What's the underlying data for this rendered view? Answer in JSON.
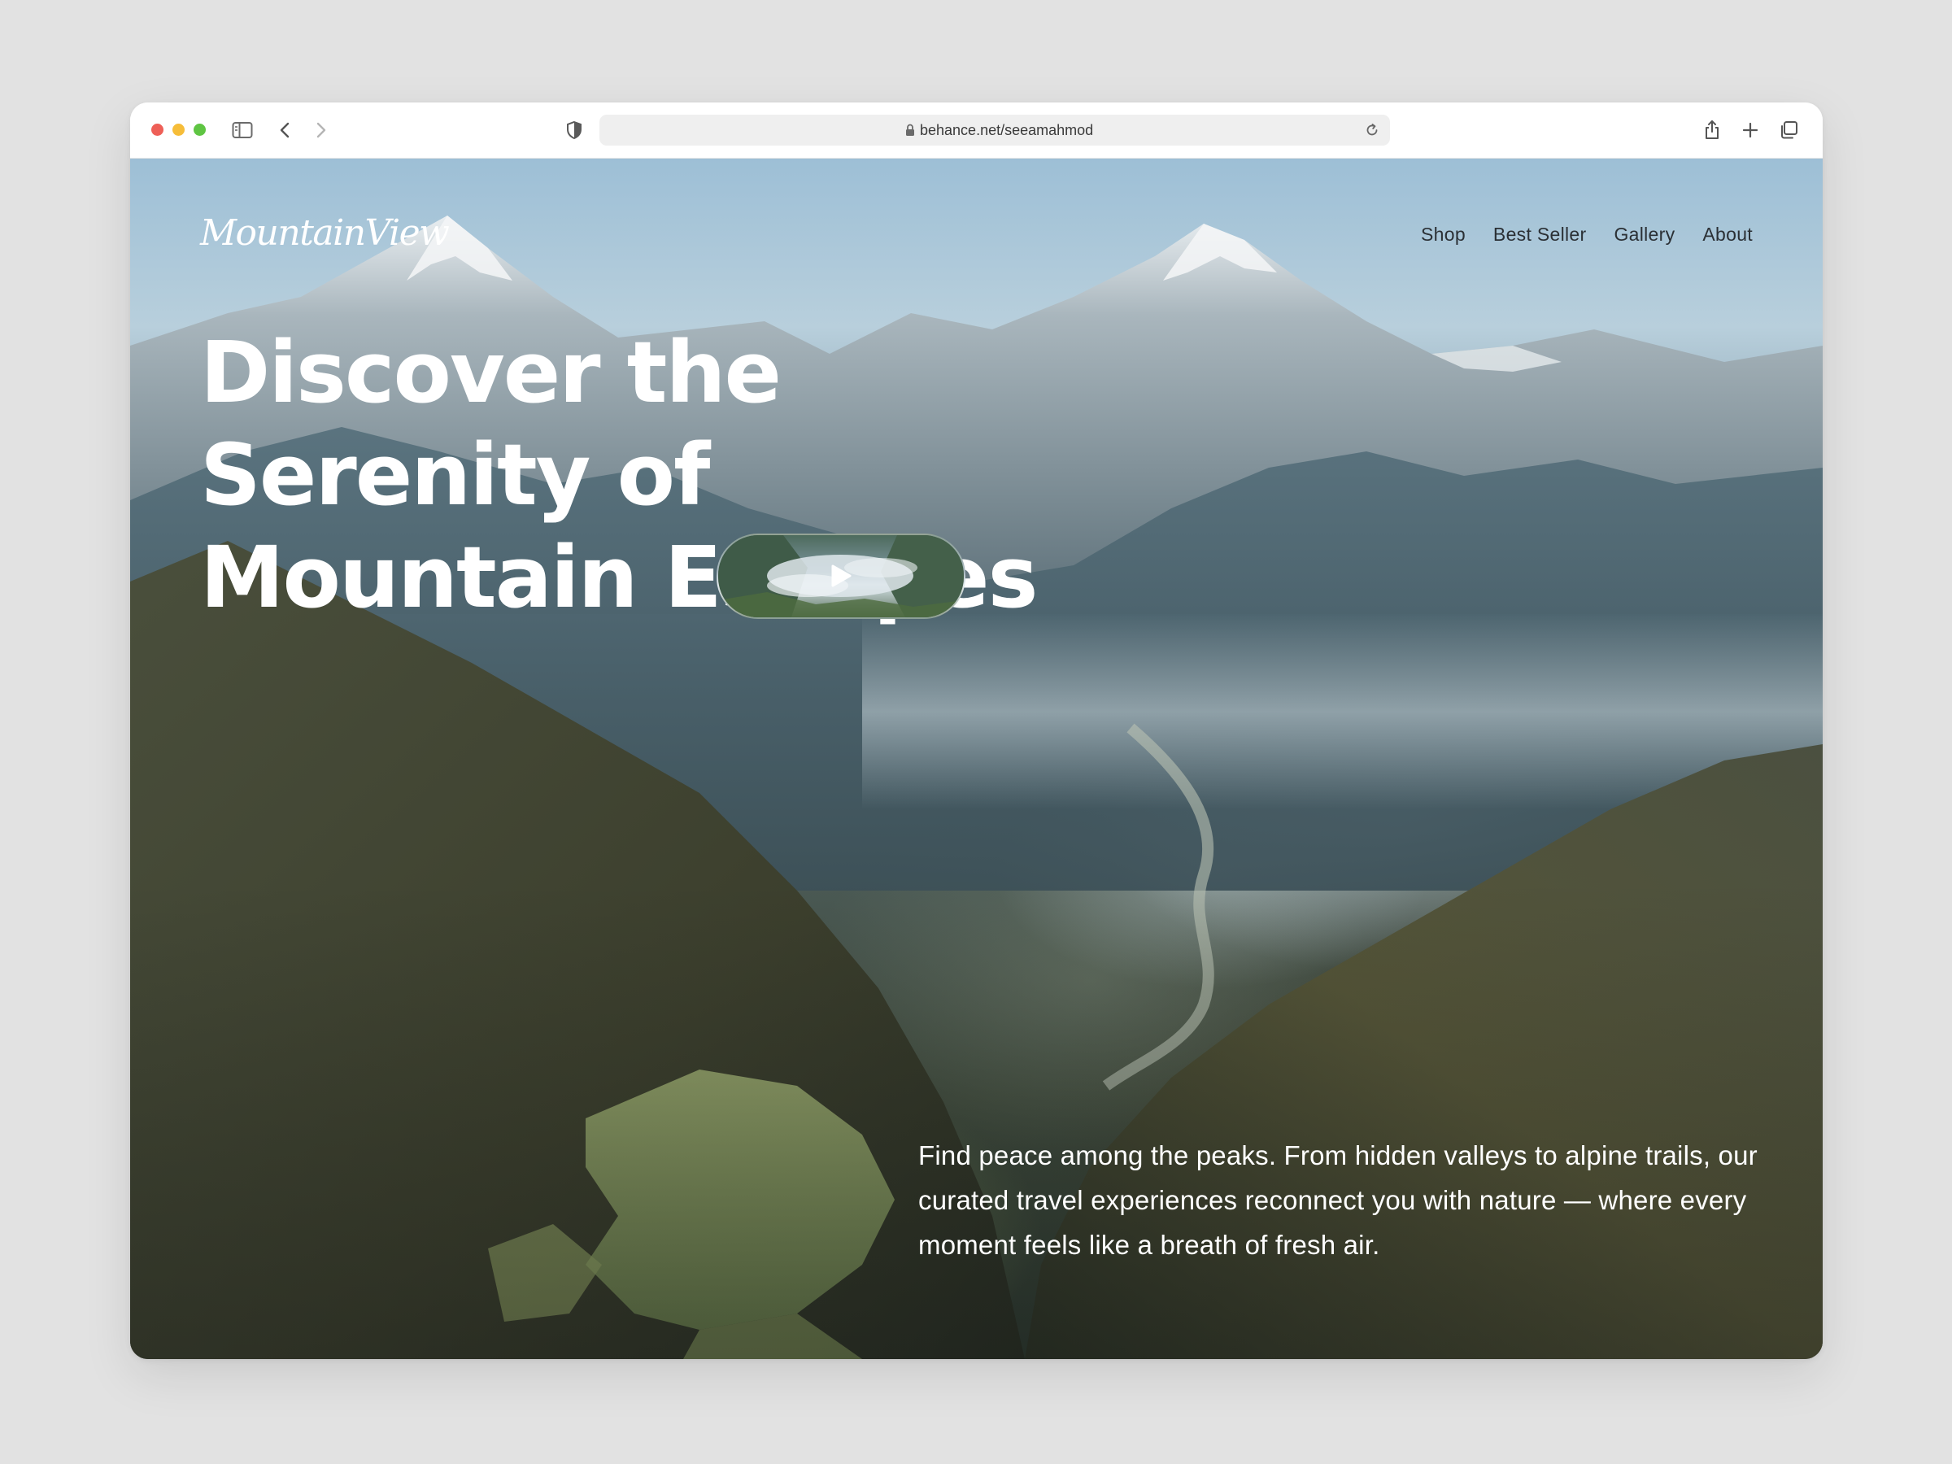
{
  "browser": {
    "url": "behance.net/seeamahmod",
    "icons": [
      "sidebar-icon",
      "back-icon",
      "forward-icon",
      "shield-icon",
      "lock-icon",
      "reload-icon",
      "share-icon",
      "new-tab-icon",
      "tabs-overview-icon"
    ]
  },
  "site": {
    "logo": "MountainView",
    "nav": [
      "Shop",
      "Best Seller",
      "Gallery",
      "About"
    ],
    "headline": [
      "Discover the",
      "Serenity of",
      "Mountain Escapes"
    ],
    "tagline": "Find peace among the peaks. From hidden valleys to alpine trails, our curated travel experiences reconnect you with nature — where every moment feels like a breath of fresh air.",
    "video_icon": "play-icon"
  },
  "colors": {
    "text_light": "#ffffff",
    "nav_text": "#2b3035",
    "traffic_red": "#ee5f57",
    "traffic_yellow": "#f6bd39",
    "traffic_green": "#5fc543"
  }
}
